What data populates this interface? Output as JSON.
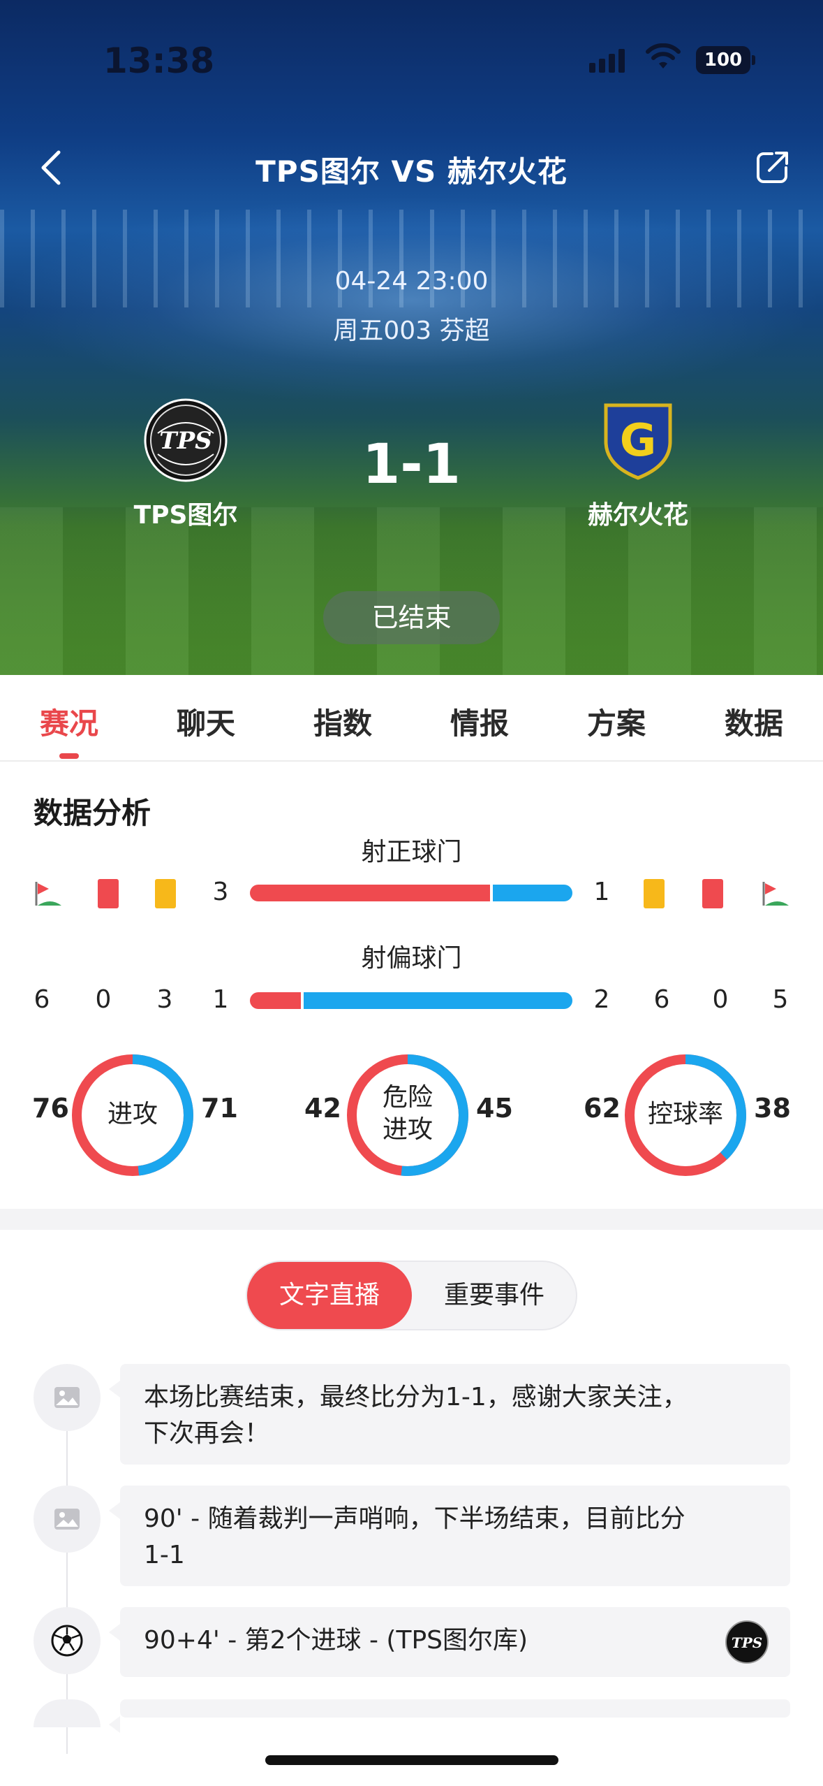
{
  "status_bar": {
    "time": "13:38",
    "battery": "100"
  },
  "header": {
    "title": "TPS图尔 VS 赫尔火花"
  },
  "match": {
    "datetime": "04-24 23:00",
    "league_info": "周五003 芬超",
    "home_team": "TPS图尔",
    "away_team": "赫尔火花",
    "score": "1-1",
    "status": "已结束",
    "home_logo_text": "TPS",
    "away_logo_text": "G"
  },
  "tabs": [
    {
      "label": "赛况",
      "active": true
    },
    {
      "label": "聊天",
      "active": false
    },
    {
      "label": "指数",
      "active": false
    },
    {
      "label": "情报",
      "active": false
    },
    {
      "label": "方案",
      "active": false
    },
    {
      "label": "数据",
      "active": false
    }
  ],
  "analysis": {
    "title": "数据分析",
    "shots_on_target": {
      "label": "射正球门",
      "home": "3",
      "away": "1",
      "home_fraction": 0.75
    },
    "shots_off_target": {
      "label": "射偏球门",
      "home": "1",
      "away": "2",
      "home_fraction": 0.16
    },
    "home_counts": {
      "corners": "6",
      "red_cards": "0",
      "yellow_cards": "3"
    },
    "away_counts": {
      "yellow_cards": "6",
      "red_cards": "0",
      "corners": "5"
    },
    "colors": {
      "home": "#ef4a4f",
      "away": "#1ba6ee"
    },
    "donuts": [
      {
        "label": "进攻",
        "home": "76",
        "away": "71"
      },
      {
        "label_line1": "危险",
        "label_line2": "进攻",
        "home": "42",
        "away": "45"
      },
      {
        "label": "控球率",
        "home": "62",
        "away": "38"
      }
    ]
  },
  "live": {
    "segment": {
      "active": "文字直播",
      "inactive": "重要事件"
    },
    "events": [
      {
        "icon": "image-icon",
        "text_line1": "本场比赛结束，最终比分为1-1，感谢大家关注，",
        "text_line2": "下次再会！"
      },
      {
        "icon": "image-icon",
        "text_line1": "90' - 随着裁判一声哨响，下半场结束，目前比分",
        "text_line2": "1-1"
      },
      {
        "icon": "soccer-ball-icon",
        "text_line1": "90+4' - 第2个进球 - (TPS图尔库)"
      }
    ]
  }
}
